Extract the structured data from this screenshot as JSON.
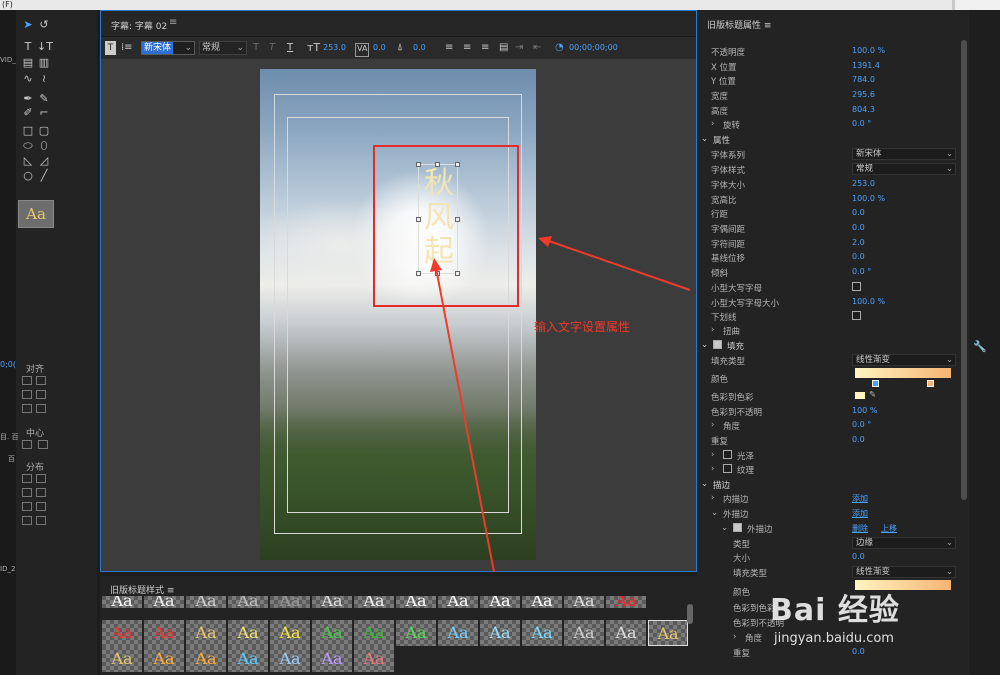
{
  "menu_fragment": "(F)",
  "tools": {
    "left_fragments": [
      "VID_",
      "0;0(",
      "目. 百",
      "百",
      "ID_2"
    ],
    "align_label": "对齐",
    "center_label": "中心",
    "distribute_label": "分布",
    "sample_text": "Aa"
  },
  "title_panel": {
    "title": "字幕: 字幕 02",
    "menu_icon": "≡",
    "toolbar": {
      "font_name": "新宋体",
      "font_style": "常规",
      "font_size": "253.0",
      "kerning": "0.0",
      "baseline": "0.0",
      "timecode": "00;00;00;00"
    },
    "text_glyphs": [
      "秋",
      "风",
      "起"
    ]
  },
  "annotation": "输入文字设置属性",
  "styles_panel": {
    "title": "旧版标题样式",
    "menu_icon": "≡",
    "sample": "Aa"
  },
  "props_panel": {
    "title": "旧版标题属性",
    "menu_icon": "≡",
    "transform": [
      {
        "label": "不透明度",
        "value": "100.0 %"
      },
      {
        "label": "X 位置",
        "value": "1391.4"
      },
      {
        "label": "Y 位置",
        "value": "784.0"
      },
      {
        "label": "宽度",
        "value": "295.6"
      },
      {
        "label": "高度",
        "value": "804.3"
      },
      {
        "label": "旋转",
        "value": "0.0 °"
      }
    ],
    "properties_header": "属性",
    "properties": [
      {
        "label": "字体系列",
        "select": "新宋体"
      },
      {
        "label": "字体样式",
        "select": "常规"
      },
      {
        "label": "字体大小",
        "value": "253.0"
      },
      {
        "label": "宽高比",
        "value": "100.0 %"
      },
      {
        "label": "行距",
        "value": "0.0"
      },
      {
        "label": "字偶间距",
        "value": "0.0"
      },
      {
        "label": "字符间距",
        "value": "2.0"
      },
      {
        "label": "基线位移",
        "value": "0.0"
      },
      {
        "label": "倾斜",
        "value": "0.0 °"
      },
      {
        "label": "小型大写字母",
        "check": false
      },
      {
        "label": "小型大写字母大小",
        "value": "100.0 %"
      },
      {
        "label": "下划线",
        "check": false
      },
      {
        "label": "扭曲",
        "value": ""
      }
    ],
    "fill_header": "填充",
    "fill": {
      "type_label": "填充类型",
      "type_value": "线性渐变",
      "color_label": "颜色",
      "color_to_color_label": "色彩到色彩",
      "color_to_opacity_label": "色彩到不透明",
      "color_to_opacity_value": "100 %",
      "angle_label": "角度",
      "angle_value": "0.0 °",
      "repeat_label": "重复",
      "repeat_value": "0.0",
      "sheen_label": "光泽",
      "texture_label": "纹理",
      "gradient_start": "#fff4c0",
      "gradient_end": "#f6b474"
    },
    "stroke_header": "描边",
    "stroke": {
      "inner_label": "内描边",
      "inner_action": "添加",
      "outer_label": "外描边",
      "outer_action": "添加",
      "outer_item_label": "外描边",
      "delete_action": "删除",
      "move_up_action": "上移",
      "type_label": "类型",
      "type_value": "边缘",
      "size_label": "大小",
      "size_value": "0.0",
      "fill_type_label": "填充类型",
      "fill_type_value": "线性渐变",
      "color_label": "颜色",
      "c2c_label": "色彩到色彩",
      "c2o_label": "色彩到不透明",
      "angle_label": "角度",
      "repeat_label": "重复",
      "repeat_value": "0.0"
    }
  },
  "watermark": {
    "brand": "Bai  经验",
    "url": "jingyan.baidu.com"
  }
}
